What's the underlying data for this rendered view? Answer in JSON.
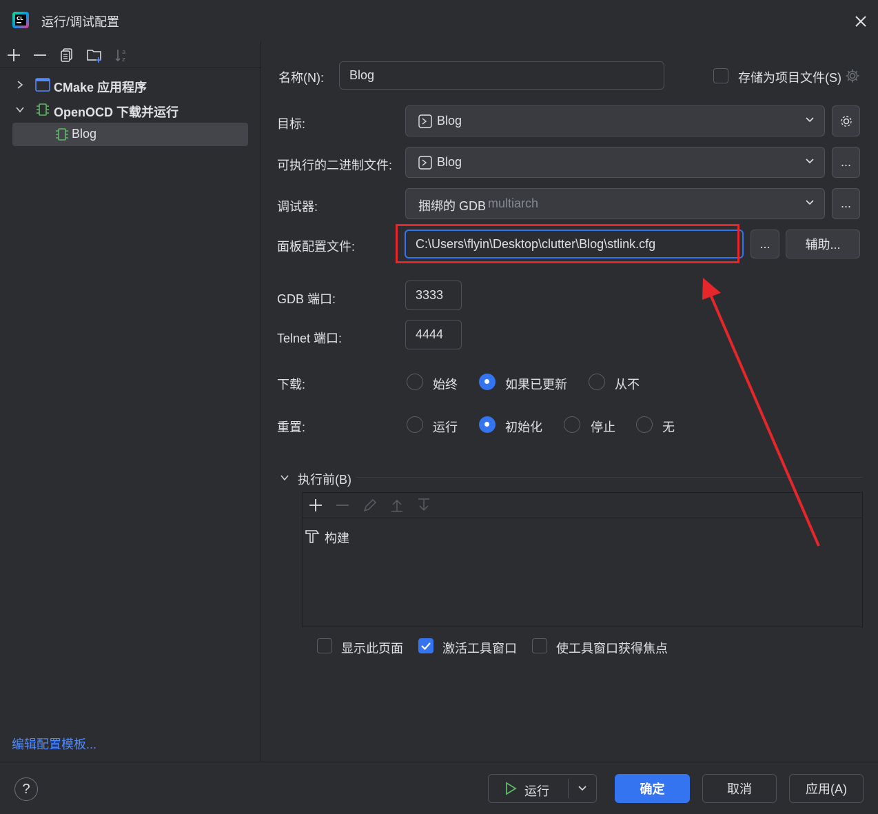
{
  "window": {
    "title": "运行/调试配置"
  },
  "left": {
    "toolbar_icons": [
      "add-icon",
      "remove-icon",
      "copy-icon",
      "new-folder-icon",
      "sort-icon"
    ],
    "tree": [
      {
        "label": "CMake 应用程序",
        "expanded": false,
        "icon": "cmake-app-icon"
      },
      {
        "label": "OpenOCD 下载并运行",
        "expanded": true,
        "icon": "openocd-chip-icon"
      },
      {
        "label": "Blog",
        "selected": true,
        "icon": "openocd-chip-icon"
      }
    ],
    "edit_templates_link": "编辑配置模板..."
  },
  "form": {
    "name_label": "名称(N):",
    "name_value": "Blog",
    "store_as_project_file": "存储为项目文件(S)",
    "target_label": "目标:",
    "target_value": "Blog",
    "executable_label": "可执行的二进制文件:",
    "executable_value": "Blog",
    "debugger_label": "调试器:",
    "debugger_value": "捆绑的 GDB",
    "debugger_hint": "multiarch",
    "board_config_label": "面板配置文件:",
    "board_config_value": "C:\\Users\\flyin\\Desktop\\clutter\\Blog\\stlink.cfg",
    "ellipsis": "...",
    "assist_button": "辅助...",
    "gdb_port_label": "GDB 端口:",
    "gdb_port_value": "3333",
    "telnet_port_label": "Telnet 端口:",
    "telnet_port_value": "4444",
    "download_label": "下载:",
    "download_options": [
      "始终",
      "如果已更新",
      "从不"
    ],
    "download_selected": "如果已更新",
    "reset_label": "重置:",
    "reset_options": [
      "运行",
      "初始化",
      "停止",
      "无"
    ],
    "reset_selected": "初始化",
    "before_launch_label": "执行前(B)",
    "before_launch_items": [
      {
        "label": "构建",
        "icon": "build-hammer-icon"
      }
    ],
    "show_page": "显示此页面",
    "activate_tool_window": "激活工具窗口",
    "focus_tool_window": "使工具窗口获得焦点",
    "checkbox_states": {
      "show_page": false,
      "activate_tool_window": true,
      "focus_tool_window": false
    }
  },
  "footer": {
    "help": "?",
    "run": "运行",
    "ok": "确定",
    "cancel": "取消",
    "apply": "应用(A)"
  },
  "colors": {
    "background": "#2b2d30",
    "accent": "#3574f0",
    "annotation_red": "#e5262b",
    "link": "#548af7"
  }
}
